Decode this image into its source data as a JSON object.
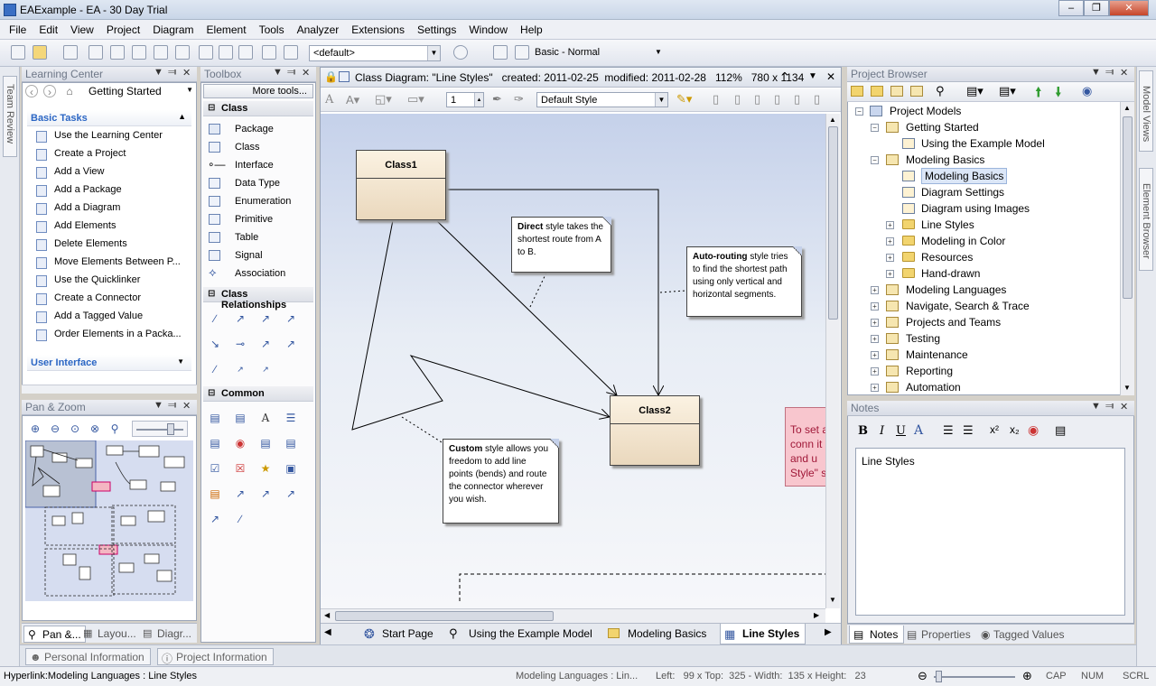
{
  "window": {
    "title": "EAExample - EA - 30 Day Trial"
  },
  "menu": [
    "File",
    "Edit",
    "View",
    "Project",
    "Diagram",
    "Element",
    "Tools",
    "Analyzer",
    "Extensions",
    "Settings",
    "Window",
    "Help"
  ],
  "toolbar": {
    "default_combo": "<default>",
    "workspace_combo": "Basic - Normal"
  },
  "left_tabs": {
    "team_review": "Team Review"
  },
  "learning_center": {
    "header": "Learning Center",
    "dropdown": "Getting Started",
    "basic_tasks": "Basic Tasks",
    "items": [
      "Use the Learning Center",
      "Create a Project",
      "Add a View",
      "Add a Package",
      "Add a Diagram",
      "Add Elements",
      "Delete Elements",
      "Move Elements Between P...",
      "Use the Quicklinker",
      "Create a Connector",
      "Add a Tagged Value",
      "Order Elements in a Packa..."
    ],
    "user_interface": "User Interface"
  },
  "pan_zoom": {
    "header": "Pan & Zoom",
    "tabs": [
      "Pan &...",
      "Layou...",
      "Diagr..."
    ]
  },
  "toolbox": {
    "header": "Toolbox",
    "more_tools": "More tools...",
    "class_section": "Class",
    "class_items": [
      "Package",
      "Class",
      "Interface",
      "Data Type",
      "Enumeration",
      "Primitive",
      "Table",
      "Signal",
      "Association"
    ],
    "relationships_section": "Class Relationships",
    "common_section": "Common"
  },
  "diagram": {
    "title": "Class Diagram: \"Line Styles\"   created: 2011-02-25  modified: 2011-02-28   112%   780 x 1134",
    "font_size": "1",
    "style_combo": "Default Style",
    "class1": "Class1",
    "class2": "Class2",
    "note_direct_bold": "Direct",
    "note_direct_text": " style takes the shortest route from A to B.",
    "note_auto_bold": "Auto-routing",
    "note_auto_text": " style tries to find the shortest path using only vertical and horizontal segments.",
    "note_custom_bold": "Custom",
    "note_custom_text": " style allows you freedom to add line points (bends) and route the connector wherever you wish.",
    "note_pink_text": "To set a conn it and u Style\" s",
    "tabs": [
      "Start Page",
      "Using the Example Model",
      "Modeling Basics",
      "Line Styles"
    ]
  },
  "project_browser": {
    "header": "Project Browser",
    "root": "Project Models",
    "items": [
      {
        "label": "Getting Started",
        "level": 1,
        "type": "pkg",
        "exp": "-"
      },
      {
        "label": "Using the Example Model",
        "level": 2,
        "type": "diag",
        "exp": ""
      },
      {
        "label": "Modeling Basics",
        "level": 1,
        "type": "pkg",
        "exp": "-"
      },
      {
        "label": "Modeling Basics",
        "level": 2,
        "type": "diag",
        "exp": ""
      },
      {
        "label": "Diagram Settings",
        "level": 2,
        "type": "diag",
        "exp": ""
      },
      {
        "label": "Diagram using Images",
        "level": 2,
        "type": "diag",
        "exp": ""
      },
      {
        "label": "Line Styles",
        "level": 2,
        "type": "folder",
        "exp": "+"
      },
      {
        "label": "Modeling in Color",
        "level": 2,
        "type": "folder",
        "exp": "+"
      },
      {
        "label": "Resources",
        "level": 2,
        "type": "folder",
        "exp": "+"
      },
      {
        "label": "Hand-drawn",
        "level": 2,
        "type": "folder",
        "exp": "+"
      },
      {
        "label": "Modeling Languages",
        "level": 1,
        "type": "pkg",
        "exp": "+"
      },
      {
        "label": "Navigate, Search & Trace",
        "level": 1,
        "type": "pkg",
        "exp": "+"
      },
      {
        "label": "Projects and Teams",
        "level": 1,
        "type": "pkg",
        "exp": "+"
      },
      {
        "label": "Testing",
        "level": 1,
        "type": "pkg",
        "exp": "+"
      },
      {
        "label": "Maintenance",
        "level": 1,
        "type": "pkg",
        "exp": "+"
      },
      {
        "label": "Reporting",
        "level": 1,
        "type": "pkg",
        "exp": "+"
      },
      {
        "label": "Automation",
        "level": 1,
        "type": "pkg",
        "exp": "+"
      }
    ]
  },
  "right_tabs": {
    "model_views": "Model Views",
    "element_browser": "Element Browser"
  },
  "notes": {
    "header": "Notes",
    "content": "Line Styles",
    "tabs": [
      "Notes",
      "Properties",
      "Tagged Values"
    ]
  },
  "bottom_tabs": [
    "Personal Information",
    "Project Information"
  ],
  "status": {
    "hyperlink": "Hyperlink:Modeling Languages : Line Styles",
    "element": "Modeling Languages : Lin...",
    "geometry": "Left:   99 x Top:  325 - Width:  135 x Height:   23",
    "cap": "CAP",
    "num": "NUM",
    "scrl": "SCRL"
  }
}
